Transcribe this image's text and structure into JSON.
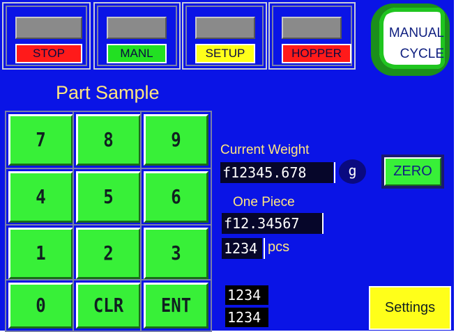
{
  "status_tiles": [
    {
      "label": "STOP",
      "tag_color": "#ff1a1a",
      "lamp_color": "#8a8a8a"
    },
    {
      "label": "MANL",
      "tag_color": "#22e022",
      "lamp_color": "#8a8a8a"
    },
    {
      "label": "SETUP",
      "tag_color": "#ffff1a",
      "lamp_color": "#8a8a8a"
    },
    {
      "label": "HOPPER",
      "tag_color": "#ff1a1a",
      "lamp_color": "#8a8a8a"
    }
  ],
  "manual_cycle": {
    "line1": "MANUAL",
    "line2": "CYCLE"
  },
  "title": "Part Sample",
  "keypad": [
    "7",
    "8",
    "9",
    "4",
    "5",
    "6",
    "1",
    "2",
    "3",
    "0",
    "CLR",
    "ENT"
  ],
  "current_weight": {
    "label": "Current Weight",
    "value": "f12345.678",
    "unit": "g"
  },
  "zero_label": "ZERO",
  "one_piece": {
    "label": "One Piece",
    "value": "f12.34567"
  },
  "count": {
    "value": "1234",
    "unit": "pcs"
  },
  "readouts": [
    "1234",
    "1234"
  ],
  "settings_label": "Settings",
  "colors": {
    "background": "#0a14e6",
    "key_green": "#38f038",
    "label_yellow": "#ffe680"
  }
}
